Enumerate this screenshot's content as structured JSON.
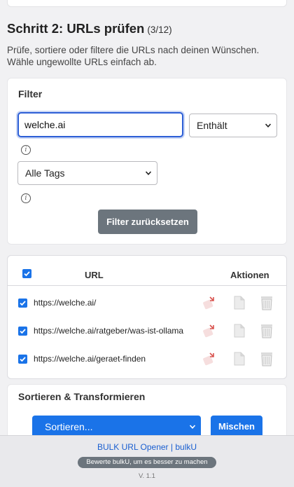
{
  "step": {
    "title": "Schritt 2: URLs prüfen",
    "count": "(3/12)",
    "description": "Prüfe, sortiere oder filtere die URLs nach deinen Wünschen. Wähle ungewollte URLs einfach ab."
  },
  "filter": {
    "heading": "Filter",
    "input_value": "welche.ai",
    "match_mode": "Enthält",
    "tag_select": "Alle Tags",
    "reset_label": "Filter zurücksetzen"
  },
  "table": {
    "col_url": "URL",
    "col_actions": "Aktionen",
    "rows": [
      {
        "url": "https://welche.ai/",
        "checked": true
      },
      {
        "url": "https://welche.ai/ratgeber/was-ist-ollama",
        "checked": true
      },
      {
        "url": "https://welche.ai/geraet-finden",
        "checked": true
      }
    ]
  },
  "sort": {
    "heading": "Sortieren & Transformieren",
    "select_value": "Sortieren...",
    "button_label": "Mischen"
  },
  "footer": {
    "link": "BULK URL Opener | bulkU",
    "rate": "Bewerte bulkU, um es besser zu machen",
    "version": "V. 1.1"
  },
  "colors": {
    "primary": "#1a73e8",
    "secondary": "#6c757d",
    "focus": "#2d5fd6"
  }
}
